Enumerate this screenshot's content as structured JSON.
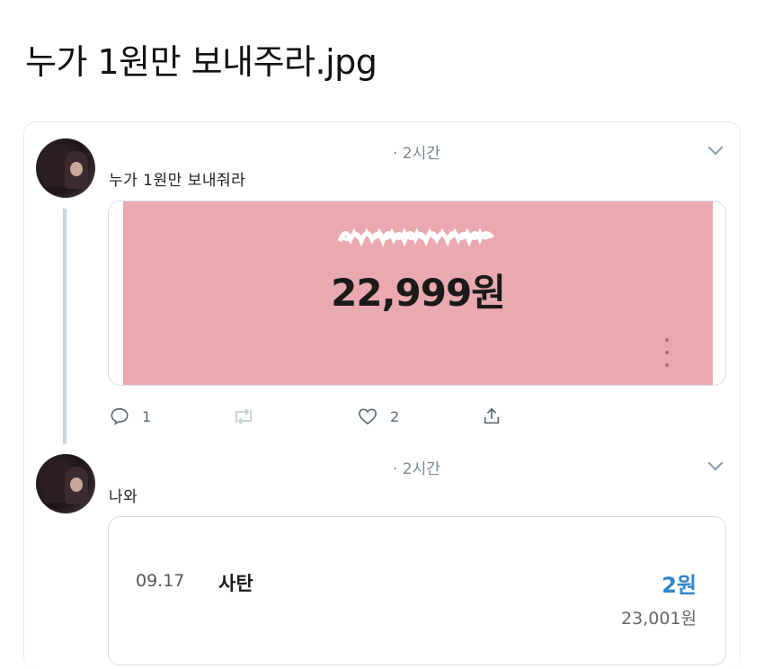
{
  "page": {
    "title": "누가 1원만 보내주라.jpg"
  },
  "tweets": [
    {
      "time": "· 2시간",
      "text": "누가 1원만 보내줘라",
      "image": {
        "amount": "22,999원"
      },
      "actions": {
        "reply_count": "1",
        "like_count": "2"
      }
    },
    {
      "time": "· 2시간",
      "text": "나와",
      "transaction": {
        "date": "09.17",
        "name": "사탄",
        "amount": "2원",
        "balance": "23,001원"
      }
    }
  ],
  "colors": {
    "image_bg": "#eaa9b0",
    "amount_blue": "#2f86c9"
  },
  "icons": [
    "reply-icon",
    "retweet-icon",
    "heart-icon",
    "share-icon",
    "chevron-down-icon",
    "more-dots-icon"
  ]
}
